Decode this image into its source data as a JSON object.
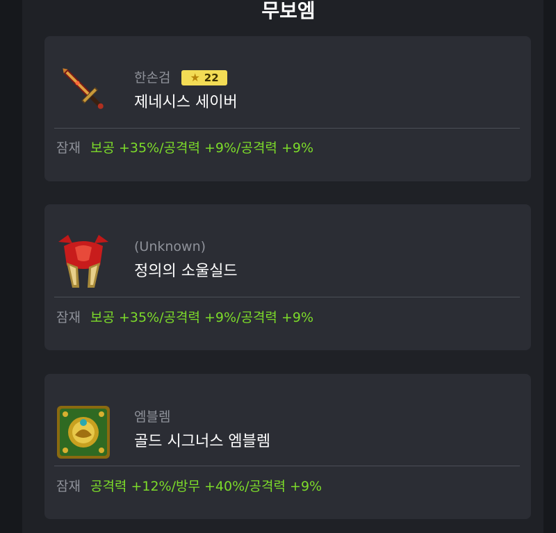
{
  "page": {
    "title": "무보엠"
  },
  "potential_label": "잠재",
  "items": [
    {
      "category": "한손검",
      "star_force": "22",
      "name": "제네시스 세이버",
      "potential": "보공 +35%/공격력 +9%/공격력 +9%",
      "icon": "sword-icon"
    },
    {
      "category": "(Unknown)",
      "name": "정의의 소울실드",
      "potential": "보공 +35%/공격력 +9%/공격력 +9%",
      "icon": "shield-icon"
    },
    {
      "category": "엠블렘",
      "name": "골드 시그너스 엠블렘",
      "potential": "공격력 +12%/방무 +40%/공격력 +9%",
      "icon": "emblem-icon"
    }
  ],
  "colors": {
    "background": "#16181c",
    "panel": "#1f2126",
    "card": "#2b2d34",
    "potential_text": "#7ddc2a",
    "star_badge": "#f3dc55"
  }
}
